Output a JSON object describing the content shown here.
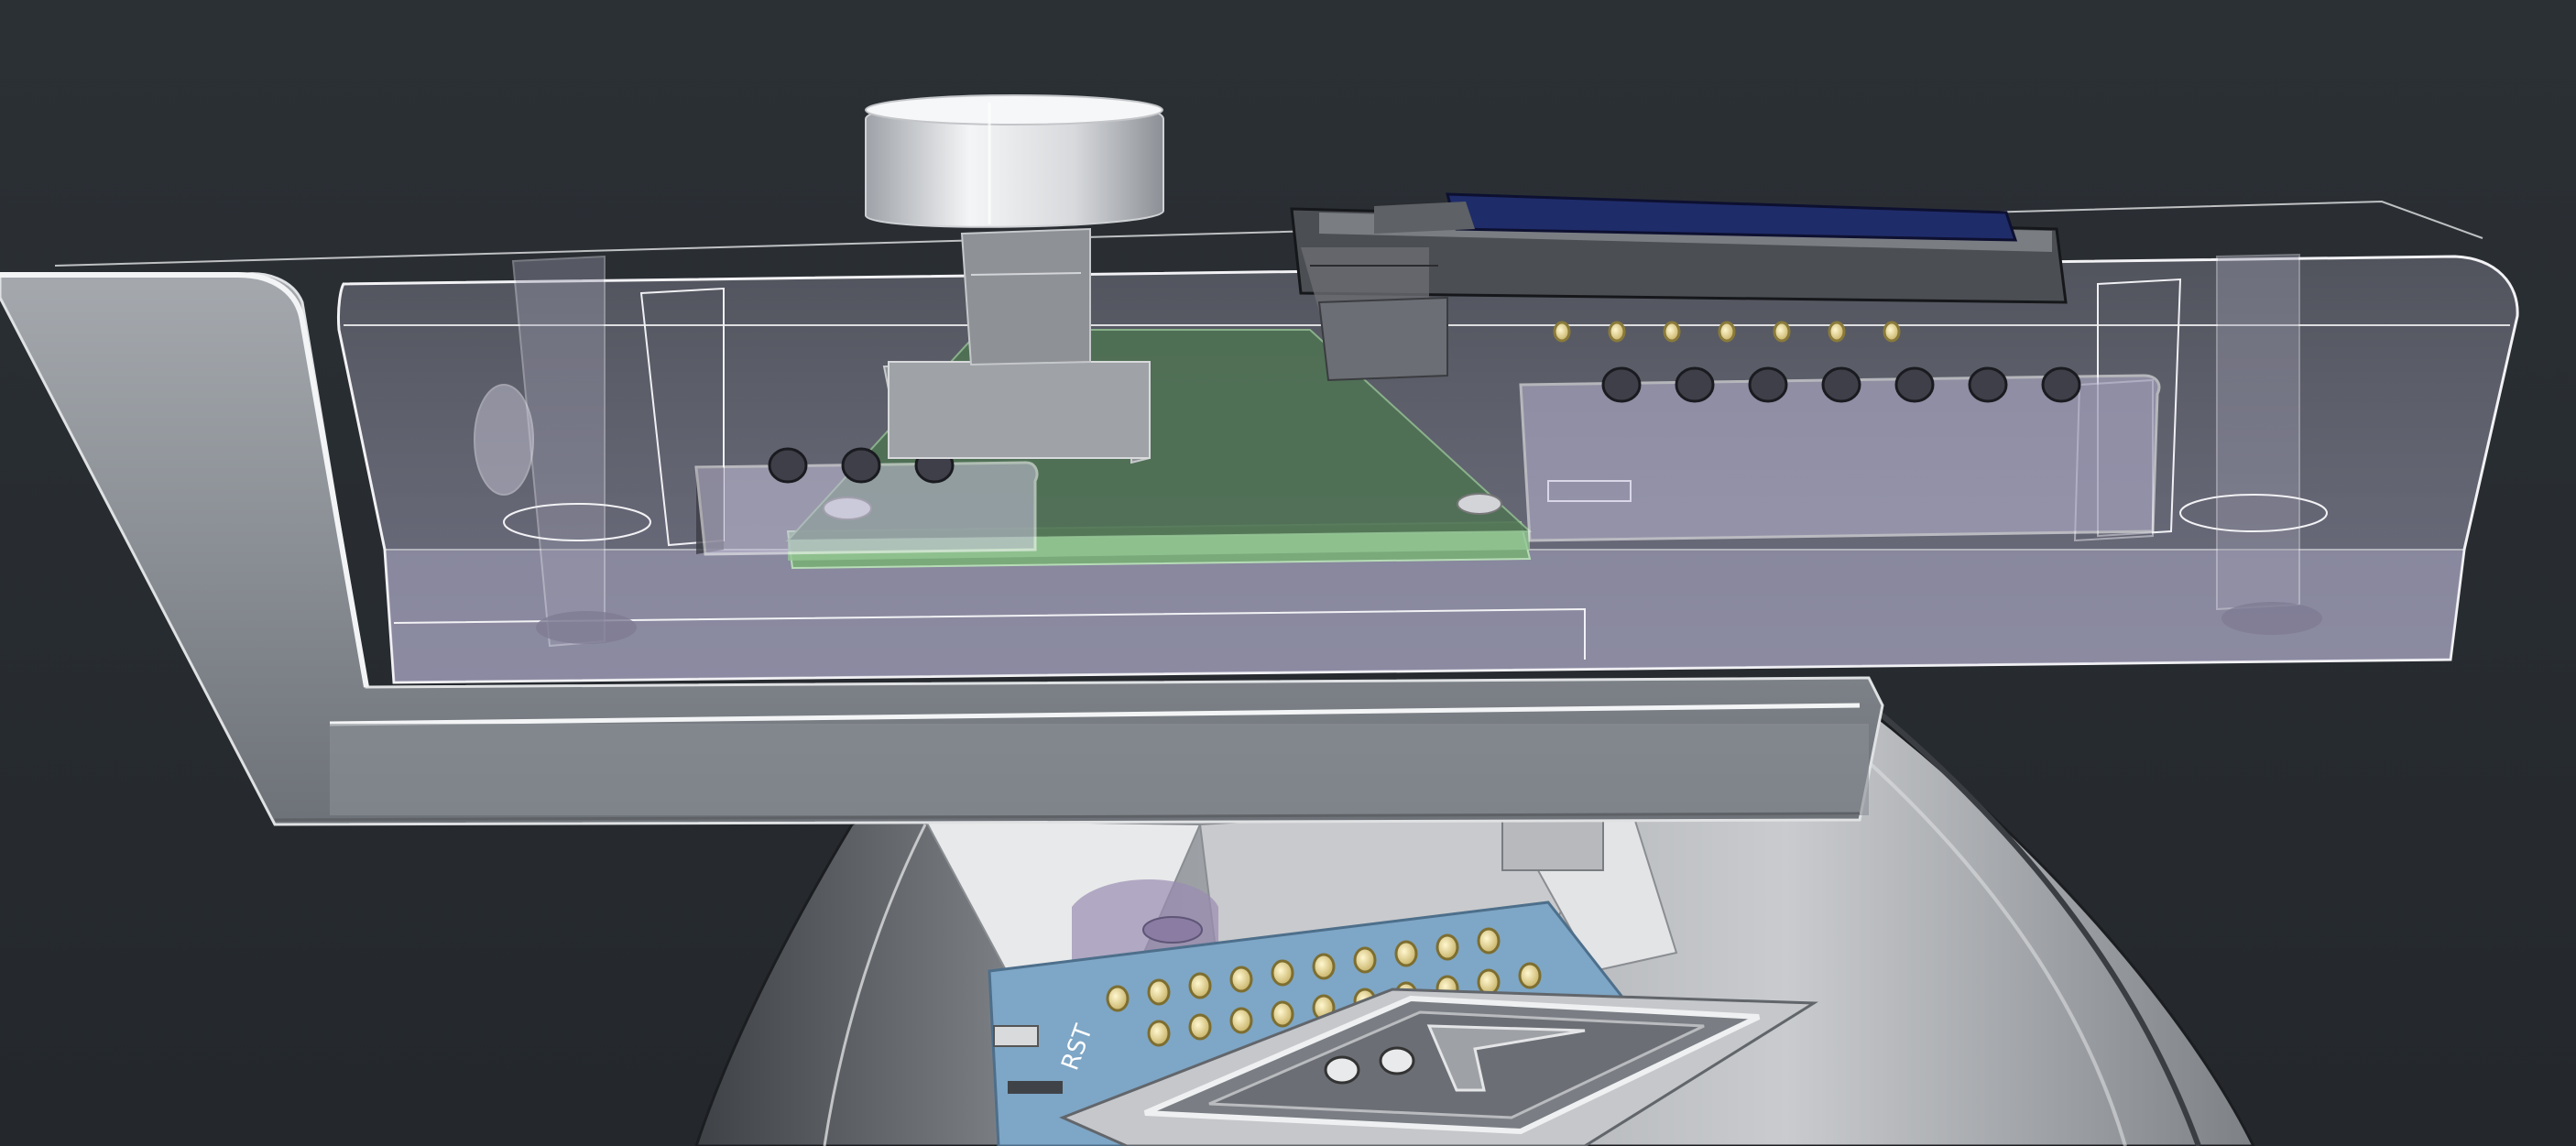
{
  "scene": {
    "type": "3d-cad-render",
    "background_color": "#262a2f",
    "objects": [
      "enclosure-bracket",
      "transparent-enclosure",
      "green-pcb",
      "rotary-knob",
      "oled-display-module",
      "lower-housing",
      "blue-microcontroller-board",
      "angled-panel"
    ]
  },
  "colors": {
    "background": "#262a2f",
    "bracket": "#8e9399",
    "enclosure_glass": "#b9b6d0",
    "pcb_green": "#6a9a6c",
    "board_blue": "#7aa3c4",
    "pin_gold": "#e7d79a",
    "display_blue": "#1f2c6a"
  },
  "lower_board": {
    "silkscreen_label": "RST"
  }
}
